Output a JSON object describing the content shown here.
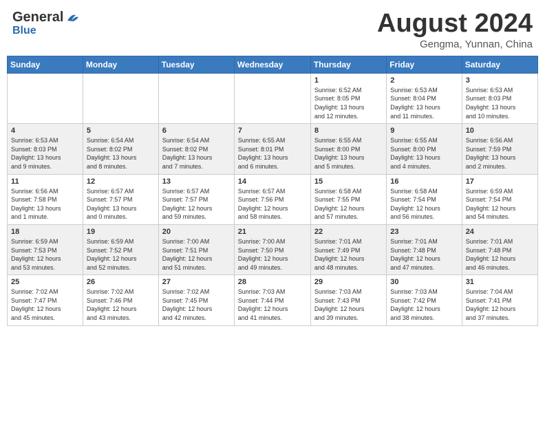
{
  "header": {
    "logo_general": "General",
    "logo_blue": "Blue",
    "month": "August 2024",
    "location": "Gengma, Yunnan, China"
  },
  "weekdays": [
    "Sunday",
    "Monday",
    "Tuesday",
    "Wednesday",
    "Thursday",
    "Friday",
    "Saturday"
  ],
  "weeks": [
    [
      {
        "day": "",
        "info": ""
      },
      {
        "day": "",
        "info": ""
      },
      {
        "day": "",
        "info": ""
      },
      {
        "day": "",
        "info": ""
      },
      {
        "day": "1",
        "info": "Sunrise: 6:52 AM\nSunset: 8:05 PM\nDaylight: 13 hours\nand 12 minutes."
      },
      {
        "day": "2",
        "info": "Sunrise: 6:53 AM\nSunset: 8:04 PM\nDaylight: 13 hours\nand 11 minutes."
      },
      {
        "day": "3",
        "info": "Sunrise: 6:53 AM\nSunset: 8:03 PM\nDaylight: 13 hours\nand 10 minutes."
      }
    ],
    [
      {
        "day": "4",
        "info": "Sunrise: 6:53 AM\nSunset: 8:03 PM\nDaylight: 13 hours\nand 9 minutes."
      },
      {
        "day": "5",
        "info": "Sunrise: 6:54 AM\nSunset: 8:02 PM\nDaylight: 13 hours\nand 8 minutes."
      },
      {
        "day": "6",
        "info": "Sunrise: 6:54 AM\nSunset: 8:02 PM\nDaylight: 13 hours\nand 7 minutes."
      },
      {
        "day": "7",
        "info": "Sunrise: 6:55 AM\nSunset: 8:01 PM\nDaylight: 13 hours\nand 6 minutes."
      },
      {
        "day": "8",
        "info": "Sunrise: 6:55 AM\nSunset: 8:00 PM\nDaylight: 13 hours\nand 5 minutes."
      },
      {
        "day": "9",
        "info": "Sunrise: 6:55 AM\nSunset: 8:00 PM\nDaylight: 13 hours\nand 4 minutes."
      },
      {
        "day": "10",
        "info": "Sunrise: 6:56 AM\nSunset: 7:59 PM\nDaylight: 13 hours\nand 2 minutes."
      }
    ],
    [
      {
        "day": "11",
        "info": "Sunrise: 6:56 AM\nSunset: 7:58 PM\nDaylight: 13 hours\nand 1 minute."
      },
      {
        "day": "12",
        "info": "Sunrise: 6:57 AM\nSunset: 7:57 PM\nDaylight: 13 hours\nand 0 minutes."
      },
      {
        "day": "13",
        "info": "Sunrise: 6:57 AM\nSunset: 7:57 PM\nDaylight: 12 hours\nand 59 minutes."
      },
      {
        "day": "14",
        "info": "Sunrise: 6:57 AM\nSunset: 7:56 PM\nDaylight: 12 hours\nand 58 minutes."
      },
      {
        "day": "15",
        "info": "Sunrise: 6:58 AM\nSunset: 7:55 PM\nDaylight: 12 hours\nand 57 minutes."
      },
      {
        "day": "16",
        "info": "Sunrise: 6:58 AM\nSunset: 7:54 PM\nDaylight: 12 hours\nand 56 minutes."
      },
      {
        "day": "17",
        "info": "Sunrise: 6:59 AM\nSunset: 7:54 PM\nDaylight: 12 hours\nand 54 minutes."
      }
    ],
    [
      {
        "day": "18",
        "info": "Sunrise: 6:59 AM\nSunset: 7:53 PM\nDaylight: 12 hours\nand 53 minutes."
      },
      {
        "day": "19",
        "info": "Sunrise: 6:59 AM\nSunset: 7:52 PM\nDaylight: 12 hours\nand 52 minutes."
      },
      {
        "day": "20",
        "info": "Sunrise: 7:00 AM\nSunset: 7:51 PM\nDaylight: 12 hours\nand 51 minutes."
      },
      {
        "day": "21",
        "info": "Sunrise: 7:00 AM\nSunset: 7:50 PM\nDaylight: 12 hours\nand 49 minutes."
      },
      {
        "day": "22",
        "info": "Sunrise: 7:01 AM\nSunset: 7:49 PM\nDaylight: 12 hours\nand 48 minutes."
      },
      {
        "day": "23",
        "info": "Sunrise: 7:01 AM\nSunset: 7:48 PM\nDaylight: 12 hours\nand 47 minutes."
      },
      {
        "day": "24",
        "info": "Sunrise: 7:01 AM\nSunset: 7:48 PM\nDaylight: 12 hours\nand 46 minutes."
      }
    ],
    [
      {
        "day": "25",
        "info": "Sunrise: 7:02 AM\nSunset: 7:47 PM\nDaylight: 12 hours\nand 45 minutes."
      },
      {
        "day": "26",
        "info": "Sunrise: 7:02 AM\nSunset: 7:46 PM\nDaylight: 12 hours\nand 43 minutes."
      },
      {
        "day": "27",
        "info": "Sunrise: 7:02 AM\nSunset: 7:45 PM\nDaylight: 12 hours\nand 42 minutes."
      },
      {
        "day": "28",
        "info": "Sunrise: 7:03 AM\nSunset: 7:44 PM\nDaylight: 12 hours\nand 41 minutes."
      },
      {
        "day": "29",
        "info": "Sunrise: 7:03 AM\nSunset: 7:43 PM\nDaylight: 12 hours\nand 39 minutes."
      },
      {
        "day": "30",
        "info": "Sunrise: 7:03 AM\nSunset: 7:42 PM\nDaylight: 12 hours\nand 38 minutes."
      },
      {
        "day": "31",
        "info": "Sunrise: 7:04 AM\nSunset: 7:41 PM\nDaylight: 12 hours\nand 37 minutes."
      }
    ]
  ]
}
